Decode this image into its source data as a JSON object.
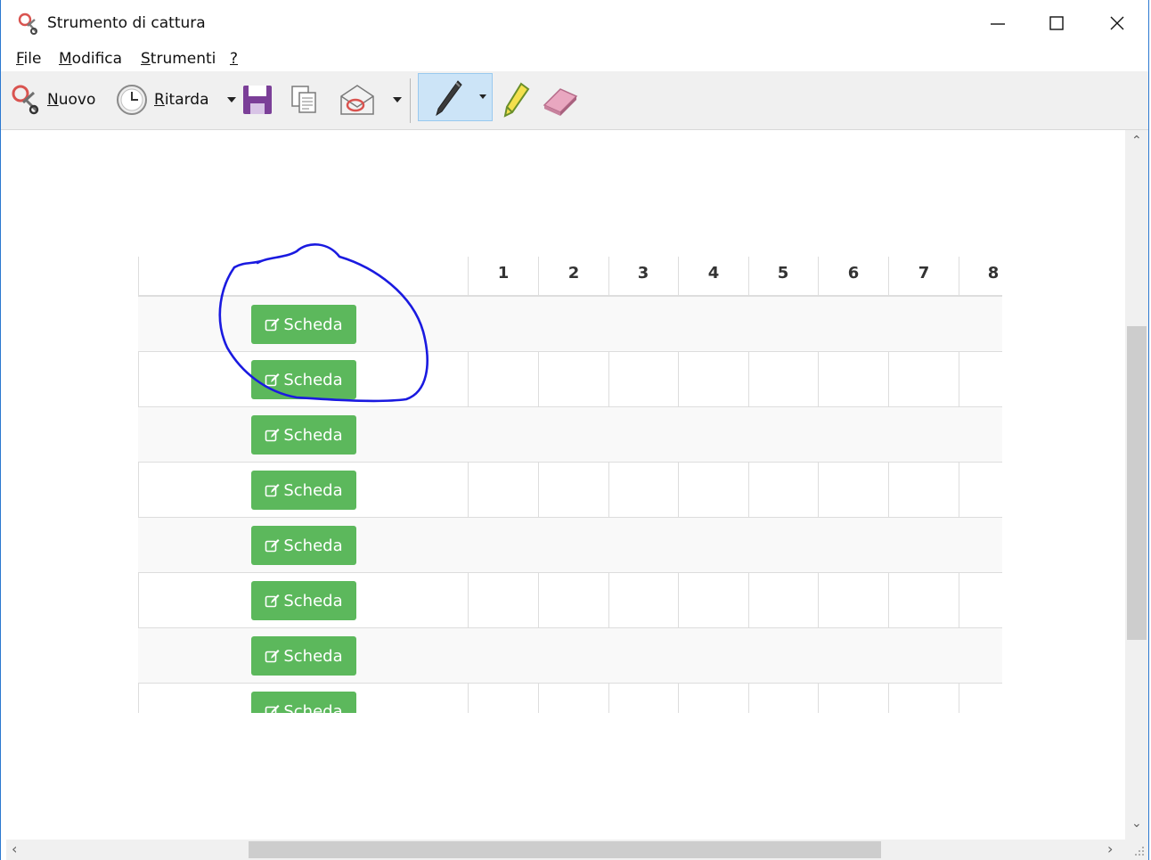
{
  "window": {
    "title": "Strumento di cattura",
    "controls": [
      "minimize-icon",
      "maximize-icon",
      "close-icon"
    ]
  },
  "menu": {
    "items": [
      {
        "key": "F",
        "rest": "ile"
      },
      {
        "key": "M",
        "rest": "odifica"
      },
      {
        "key": "S",
        "rest": "trumenti"
      },
      {
        "key": "?",
        "rest": ""
      }
    ]
  },
  "toolbar": {
    "new_key": "N",
    "new_rest": "uovo",
    "delay_key": "R",
    "delay_rest": "itarda",
    "icons": [
      "scissors-icon",
      "clock-icon",
      "save-icon",
      "copy-icon",
      "send-email-icon",
      "pen-icon",
      "highlighter-icon",
      "eraser-icon"
    ]
  },
  "table": {
    "columns": [
      "1",
      "2",
      "3",
      "4",
      "5",
      "6",
      "7",
      "8"
    ],
    "button_label": "Scheda",
    "button_icon": "edit-icon",
    "button_color": "#5cb85c"
  },
  "annotation": {
    "stroke_color": "#1a1ae0"
  }
}
